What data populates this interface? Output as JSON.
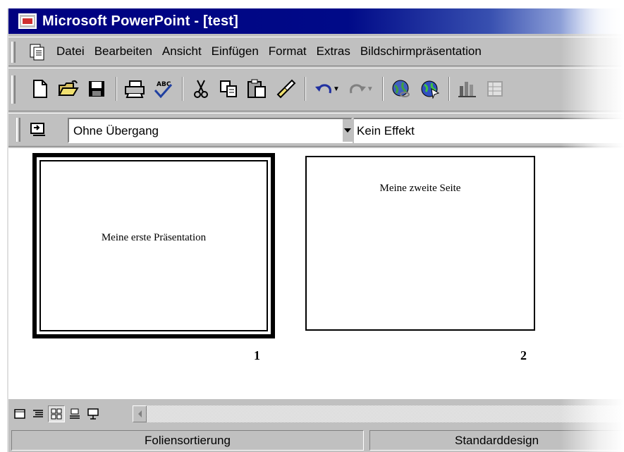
{
  "window": {
    "title": "Microsoft PowerPoint - [test]"
  },
  "menubar": {
    "items": [
      {
        "label": "Datei"
      },
      {
        "label": "Bearbeiten"
      },
      {
        "label": "Ansicht"
      },
      {
        "label": "Einfügen"
      },
      {
        "label": "Format"
      },
      {
        "label": "Extras"
      },
      {
        "label": "Bildschirmpräsentation"
      }
    ]
  },
  "toolbar": {
    "icons": [
      "new-document-icon",
      "open-folder-icon",
      "save-icon",
      "print-icon",
      "spell-check-icon",
      "cut-icon",
      "copy-icon",
      "paste-icon",
      "format-painter-icon",
      "undo-icon",
      "redo-icon",
      "insert-hyperlink-icon",
      "web-toolbar-icon",
      "insert-chart-icon",
      "insert-table-icon"
    ]
  },
  "slide_sorter_toolbar": {
    "transition_value": "Ohne Übergang",
    "effect_value": "Kein Effekt"
  },
  "slides": [
    {
      "number": "1",
      "text": "Meine erste Präsentation",
      "selected": true
    },
    {
      "number": "2",
      "text": "Meine zweite Seite",
      "selected": false
    }
  ],
  "view_buttons": [
    "normal-view-icon",
    "outline-view-icon",
    "slide-sorter-view-icon",
    "notes-view-icon",
    "slideshow-view-icon"
  ],
  "statusbar": {
    "view": "Foliensortierung",
    "design": "Standarddesign"
  }
}
